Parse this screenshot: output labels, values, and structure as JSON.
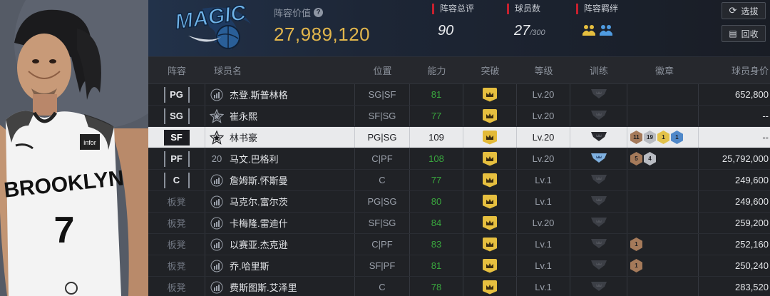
{
  "team": {
    "logo_text": "MAGIC"
  },
  "header": {
    "value_label": "阵容价值",
    "value": "27,989,120",
    "rating_label": "阵容总评",
    "rating": "90",
    "players_label": "球员数",
    "players_count": "27",
    "players_max": "/300",
    "bond_label": "阵容羁绊"
  },
  "buttons": {
    "pick_label": "选拔",
    "recycle_label": "回收"
  },
  "columns": [
    "阵容",
    "球员名",
    "位置",
    "能力",
    "突破",
    "等级",
    "训练",
    "徽章",
    "球员身价"
  ],
  "player_art": {
    "team_text": "BROOKLYN",
    "number": "7",
    "sponsor": "infor"
  },
  "colors": {
    "accent_gold": "#e2b64c",
    "ability_green": "#39a83e",
    "stat_red": "#c8202e"
  },
  "rows": [
    {
      "slot": "PG",
      "bench": false,
      "name": "杰登.斯普林格",
      "rank": "bars",
      "pos": "SG|SF",
      "ability": "81",
      "level": "Lv.20",
      "train": "dark",
      "badges": [],
      "value": "652,800",
      "selected": false
    },
    {
      "slot": "SG",
      "bench": false,
      "name": "崔永熙",
      "rank": "star",
      "pos": "SF|SG",
      "ability": "77",
      "level": "Lv.20",
      "train": "dark",
      "badges": [],
      "value": "--",
      "selected": false
    },
    {
      "slot": "SF",
      "bench": false,
      "name": "林书豪",
      "rank": "star",
      "pos": "PG|SG",
      "ability": "109",
      "level": "Lv.20",
      "train": "black",
      "badges": [
        {
          "n": "11",
          "color": "#a57a5a"
        },
        {
          "n": "19",
          "color": "#b9bcc2"
        },
        {
          "n": "1",
          "color": "#e2c24a"
        },
        {
          "n": "1",
          "color": "#4f88c9"
        }
      ],
      "value": "--",
      "selected": true
    },
    {
      "slot": "PF",
      "bench": false,
      "name": "马文.巴格利",
      "rank": "20",
      "pos": "C|PF",
      "ability": "108",
      "level": "Lv.20",
      "train": "blue",
      "badges": [
        {
          "n": "5",
          "color": "#a57a5a"
        },
        {
          "n": "4",
          "color": "#b9bcc2"
        }
      ],
      "value": "25,792,000",
      "selected": false
    },
    {
      "slot": "C",
      "bench": false,
      "name": "詹姆斯.怀斯曼",
      "rank": "bars",
      "pos": "C",
      "ability": "77",
      "level": "Lv.1",
      "train": "dark",
      "badges": [],
      "value": "249,600",
      "selected": false
    },
    {
      "slot": "板凳",
      "bench": true,
      "name": "马克尔.富尔茨",
      "rank": "bars",
      "pos": "PG|SG",
      "ability": "80",
      "level": "Lv.1",
      "train": "dark",
      "badges": [],
      "value": "249,600",
      "selected": false
    },
    {
      "slot": "板凳",
      "bench": true,
      "name": "卡梅隆.雷迪什",
      "rank": "bars",
      "pos": "SF|SG",
      "ability": "84",
      "level": "Lv.20",
      "train": "dark",
      "badges": [],
      "value": "259,200",
      "selected": false
    },
    {
      "slot": "板凳",
      "bench": true,
      "name": "以赛亚.杰克逊",
      "rank": "bars",
      "pos": "C|PF",
      "ability": "83",
      "level": "Lv.1",
      "train": "dark",
      "badges": [
        {
          "n": "1",
          "color": "#a57a5a"
        }
      ],
      "value": "252,160",
      "selected": false
    },
    {
      "slot": "板凳",
      "bench": true,
      "name": "乔.哈里斯",
      "rank": "bars",
      "pos": "SF|PF",
      "ability": "81",
      "level": "Lv.1",
      "train": "dark",
      "badges": [
        {
          "n": "1",
          "color": "#a57a5a"
        }
      ],
      "value": "250,240",
      "selected": false
    },
    {
      "slot": "板凳",
      "bench": true,
      "name": "费斯图斯.艾泽里",
      "rank": "bars",
      "pos": "C",
      "ability": "78",
      "level": "Lv.1",
      "train": "dark",
      "badges": [],
      "value": "283,520",
      "selected": false
    }
  ]
}
